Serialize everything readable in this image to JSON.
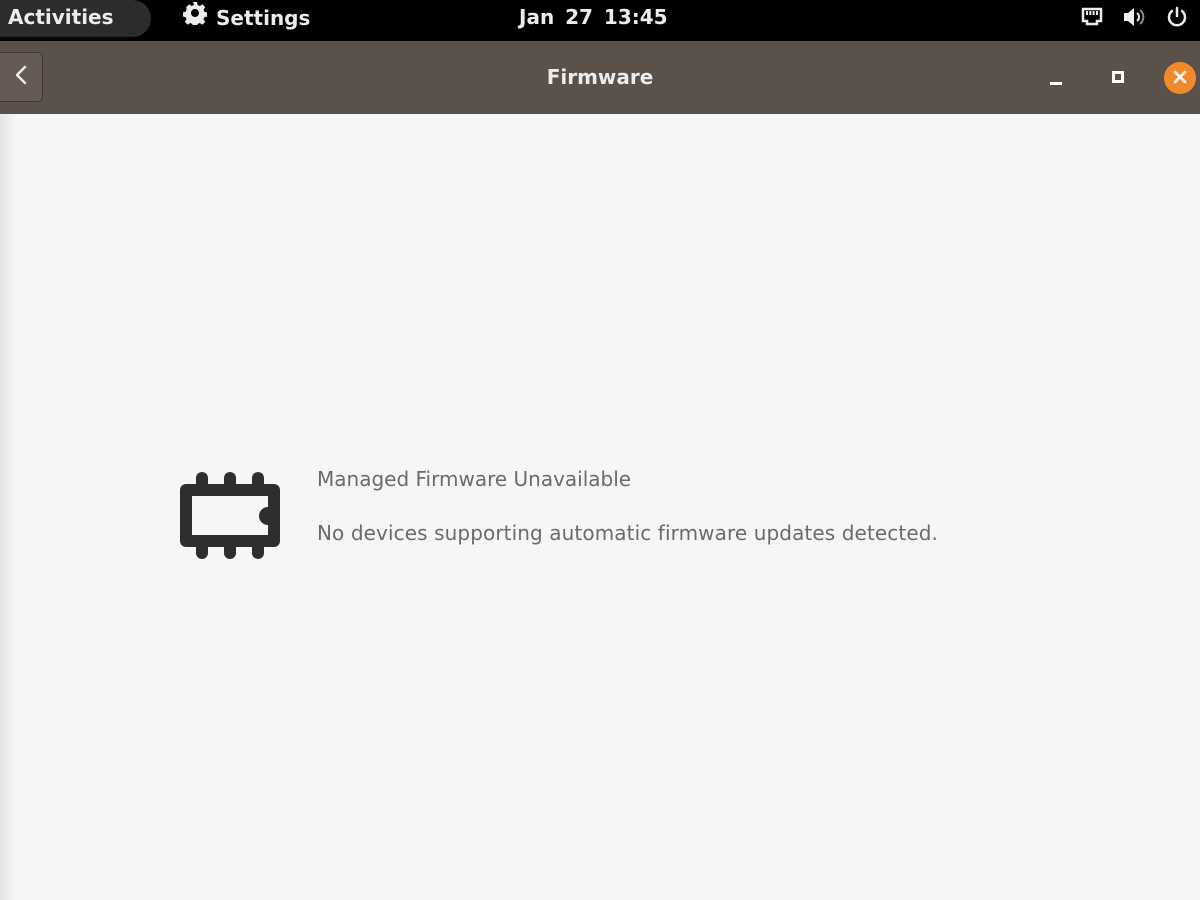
{
  "topbar": {
    "activities_label": "Activities",
    "app_name": "Settings",
    "app_icon": "gear-icon",
    "clock": "Jan 27  13:45",
    "tray_icons": [
      "network-wired-icon",
      "volume-icon",
      "power-icon"
    ]
  },
  "window": {
    "title": "Firmware",
    "back_icon": "chevron-left-icon",
    "controls": [
      "minimize",
      "maximize",
      "close"
    ],
    "close_color": "#f08a2a",
    "headerbar_color": "#5b514b"
  },
  "empty_state": {
    "icon": "chip-icon",
    "title": "Managed Firmware Unavailable",
    "description": "No devices supporting automatic firmware updates detected."
  }
}
